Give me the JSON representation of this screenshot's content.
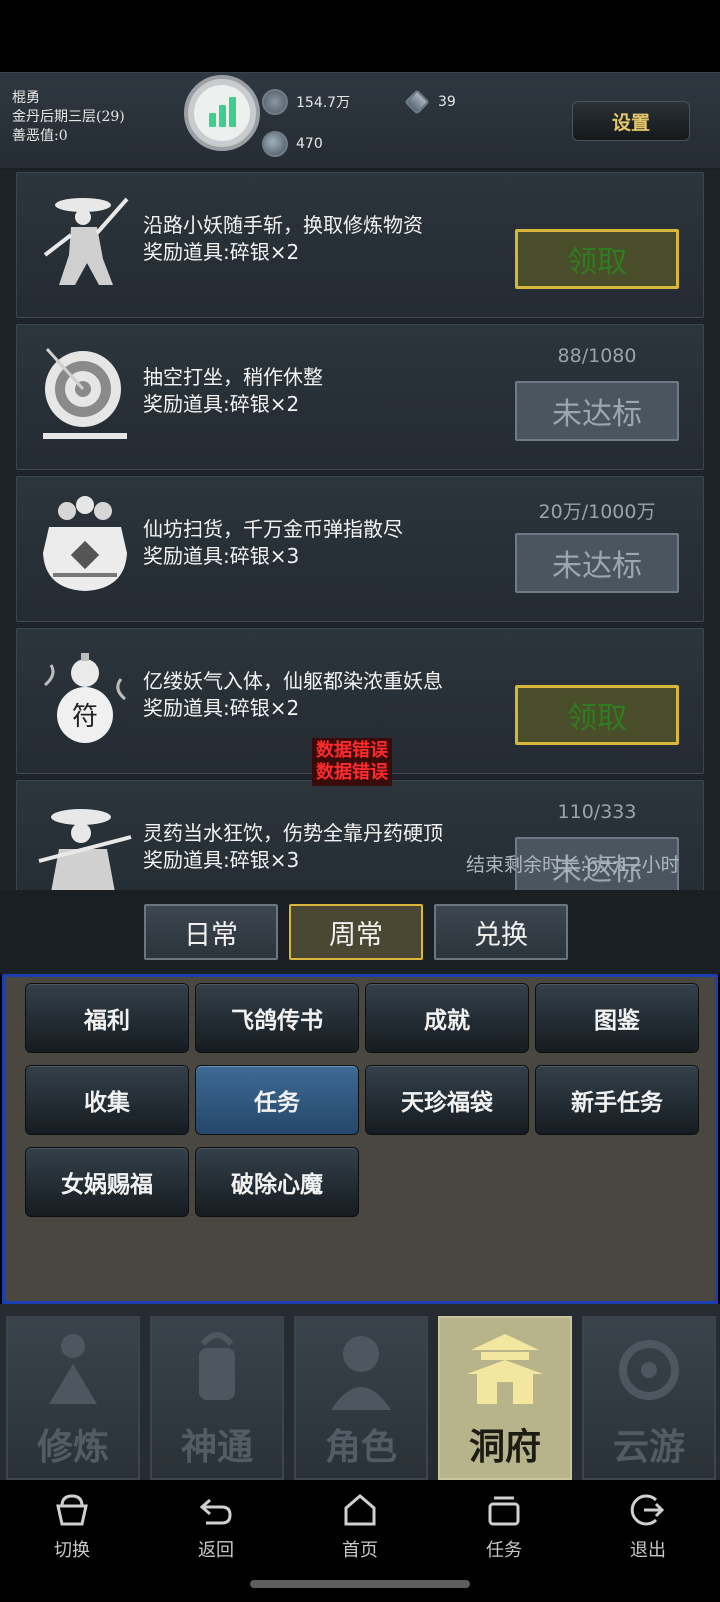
{
  "player": {
    "name": "棍勇",
    "realm": "金丹后期三层(29)",
    "karma": "善恶值:0"
  },
  "resources": {
    "coins": "154.7万",
    "crystals": "39",
    "spirit": "470"
  },
  "settings_label": "设置",
  "tasks": [
    {
      "title": "沿路小妖随手斩，换取修炼物资",
      "reward": "奖励道具:碎银×2",
      "progress": "",
      "button": "领取",
      "state": "claim",
      "icon": "swordsman-icon"
    },
    {
      "title": "抽空打坐，稍作休整",
      "reward": "奖励道具:碎银×2",
      "progress": "88/1080",
      "button": "未达标",
      "state": "locked",
      "icon": "target-icon"
    },
    {
      "title": "仙坊扫货，千万金币弹指散尽",
      "reward": "奖励道具:碎银×3",
      "progress": "20万/1000万",
      "button": "未达标",
      "state": "locked",
      "icon": "treasure-pot-icon"
    },
    {
      "title": "亿缕妖气入体，仙躯都染浓重妖息",
      "reward": "奖励道具:碎银×2",
      "progress": "",
      "button": "领取",
      "state": "claim",
      "icon": "gourd-icon"
    },
    {
      "title": "灵药当水狂饮，伤势全靠丹药硬顶",
      "reward": "奖励道具:碎银×3",
      "progress": "110/333",
      "button": "未达标",
      "state": "locked",
      "icon": "swordsman-hat-icon"
    }
  ],
  "error_text": [
    "数据错误",
    "数据错误"
  ],
  "countdown": "结束剩余时长:6天12小时",
  "tabs": [
    {
      "label": "日常"
    },
    {
      "label": "周常"
    },
    {
      "label": "兑换"
    }
  ],
  "menu": [
    {
      "label": "福利"
    },
    {
      "label": "飞鸽传书"
    },
    {
      "label": "成就"
    },
    {
      "label": "图鉴"
    },
    {
      "label": "收集"
    },
    {
      "label": "任务"
    },
    {
      "label": "天珍福袋"
    },
    {
      "label": "新手任务"
    },
    {
      "label": "女娲赐福"
    },
    {
      "label": "破除心魔"
    }
  ],
  "mainnav": [
    {
      "label": "修炼"
    },
    {
      "label": "神通"
    },
    {
      "label": "角色"
    },
    {
      "label": "洞府"
    },
    {
      "label": "云游"
    }
  ],
  "sysnav": [
    {
      "label": "切换"
    },
    {
      "label": "返回"
    },
    {
      "label": "首页"
    },
    {
      "label": "任务"
    },
    {
      "label": "退出"
    }
  ],
  "colors": {
    "claim_border": "#d8b63c",
    "claim_text": "#2f7d1e",
    "locked_text": "#9aa6b0",
    "menu_frame": "#1b3fb0",
    "error_red": "#ff2a2a"
  }
}
